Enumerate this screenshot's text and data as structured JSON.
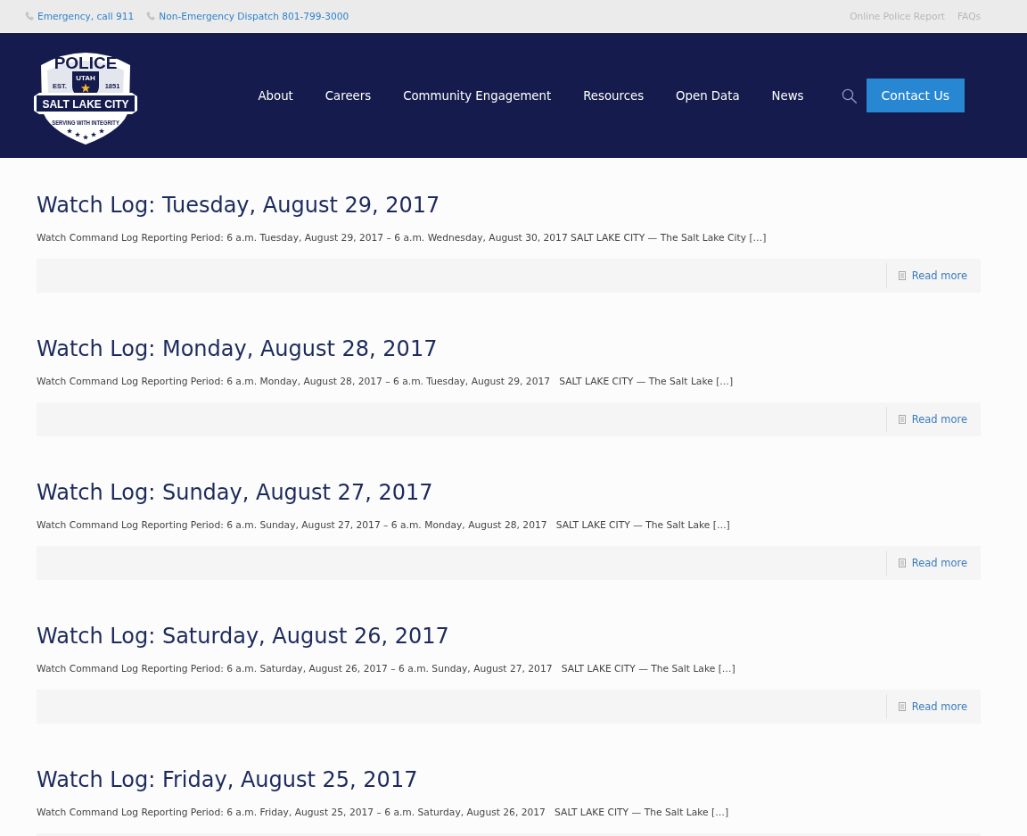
{
  "top_bar": {
    "contacts": [
      {
        "label": "Emergency, call 911"
      },
      {
        "label": "Non-Emergency Dispatch 801-799-3000"
      }
    ],
    "links": [
      "Online Police Report",
      "FAQs"
    ]
  },
  "header": {
    "logo": {
      "top": "POLICE",
      "state": "UTAH",
      "est_label": "EST.",
      "est_year": "1851",
      "city": "SALT LAKE CITY",
      "motto": "SERVING WITH INTEGRITY"
    },
    "nav": [
      "About",
      "Careers",
      "Community Engagement",
      "Resources",
      "Open Data",
      "News"
    ],
    "button": "Contact Us"
  },
  "posts": [
    {
      "title": "Watch Log: Tuesday, August 29, 2017",
      "excerpt": "Watch Command Log Reporting Period: 6 a.m. Tuesday, August 29, 2017 – 6 a.m. Wednesday, August 30, 2017 SALT LAKE CITY — The Salt Lake City […]",
      "read_more": "Read more"
    },
    {
      "title": "Watch Log: Monday, August 28, 2017",
      "excerpt": "Watch Command Log Reporting Period: 6 a.m. Monday, August 28, 2017 – 6 a.m. Tuesday, August 29, 2017   SALT LAKE CITY — The Salt Lake […]",
      "read_more": "Read more"
    },
    {
      "title": "Watch Log: Sunday, August 27, 2017",
      "excerpt": "Watch Command Log Reporting Period: 6 a.m. Sunday, August 27, 2017 – 6 a.m. Monday, August 28, 2017   SALT LAKE CITY — The Salt Lake […]",
      "read_more": "Read more"
    },
    {
      "title": "Watch Log: Saturday, August 26, 2017",
      "excerpt": "Watch Command Log Reporting Period: 6 a.m. Saturday, August 26, 2017 – 6 a.m. Sunday, August 27, 2017   SALT LAKE CITY — The Salt Lake […]",
      "read_more": "Read more"
    },
    {
      "title": "Watch Log: Friday, August 25, 2017",
      "excerpt": "Watch Command Log Reporting Period: 6 a.m. Friday, August 25, 2017 – 6 a.m. Saturday, August 26, 2017   SALT LAKE CITY — The Salt Lake […]"
    }
  ]
}
